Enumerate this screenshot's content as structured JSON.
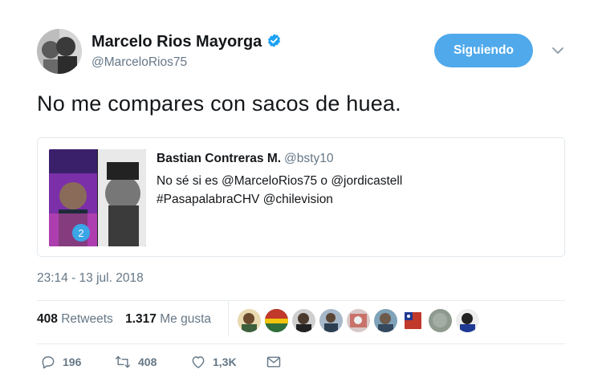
{
  "author": {
    "name": "Marcelo Rios Mayorga",
    "handle": "@MarceloRios75",
    "verified": true
  },
  "follow_button": {
    "label": "Siguiendo"
  },
  "tweet": {
    "text": "No me compares con sacos de huea.",
    "timestamp": "23:14 - 13 jul. 2018"
  },
  "quoted_tweet": {
    "author_name": "Bastian Contreras M.",
    "author_handle": "@bsty10",
    "line1": "No sé si es @MarceloRios75 o @jordicastell",
    "line2": "#PasapalabraCHV @chilevision",
    "badge": "2"
  },
  "stats": {
    "retweets_count": "408",
    "retweets_label": "Retweets",
    "likes_count": "1.317",
    "likes_label": "Me gusta"
  },
  "actions": {
    "reply_count": "196",
    "retweet_count": "408",
    "like_count": "1,3K"
  },
  "colors": {
    "accent": "#4fa9eb",
    "text": "#14171a",
    "muted": "#657786",
    "border": "#e1e8ed"
  }
}
